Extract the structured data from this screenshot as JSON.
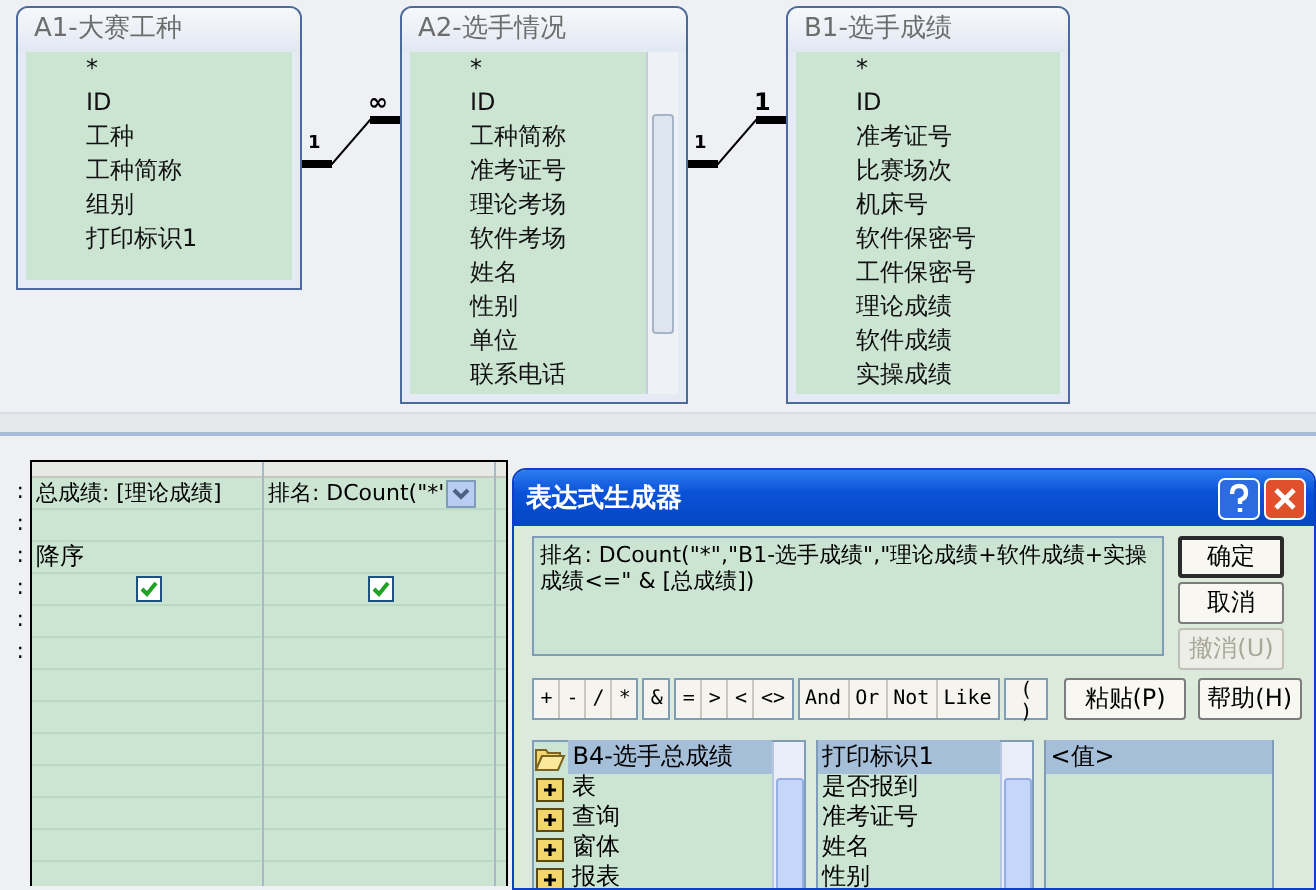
{
  "tables": [
    {
      "title": "A1-大赛工种",
      "fields": [
        "*",
        "ID",
        "工种",
        "工种简称",
        "组别",
        "打印标识1"
      ],
      "scrollbar": false
    },
    {
      "title": "A2-选手情况",
      "fields": [
        "*",
        "ID",
        "工种简称",
        "准考证号",
        "理论考场",
        "软件考场",
        "姓名",
        "性别",
        "单位",
        "联系电话"
      ],
      "scrollbar": true
    },
    {
      "title": "B1-选手成绩",
      "fields": [
        "*",
        "ID",
        "准考证号",
        "比赛场次",
        "机床号",
        "软件保密号",
        "工件保密号",
        "理论成绩",
        "软件成绩",
        "实操成绩"
      ],
      "scrollbar": false
    }
  ],
  "relationships": [
    {
      "from_label": "1",
      "to_label": "∞"
    },
    {
      "from_label": "1",
      "to_label": "1"
    }
  ],
  "grid": {
    "row_labels": [
      ":",
      ":",
      ":",
      ":",
      ":",
      ":"
    ],
    "columns": [
      {
        "field": "总成绩: [理论成绩]",
        "sort": "降序",
        "show": true,
        "dropdown": false
      },
      {
        "field": "排名: DCount(\"*'",
        "show": true,
        "dropdown": true
      }
    ]
  },
  "dialog": {
    "title": "表达式生成器",
    "expression": "排名: DCount(\"*\",\"B1-选手成绩\",\"理论成绩+软件成绩+实操成绩<=\" & [总成绩])",
    "buttons": [
      {
        "label": "确定",
        "default": true,
        "disabled": false
      },
      {
        "label": "取消",
        "default": false,
        "disabled": false
      },
      {
        "label": "撤消(U)",
        "default": false,
        "disabled": true
      }
    ],
    "operator_groups": [
      [
        "+",
        "-",
        "/",
        "*"
      ],
      [
        "&"
      ],
      [
        "=",
        ">",
        "<",
        "<>"
      ],
      [
        "And",
        "Or",
        "Not",
        "Like"
      ],
      [
        "( )"
      ]
    ],
    "paste_button": "粘贴(P)",
    "help_button": "帮助(H)",
    "tree": [
      {
        "label": "B4-选手总成绩",
        "kind": "open",
        "selected": true
      },
      {
        "label": "表",
        "kind": "closed",
        "selected": false
      },
      {
        "label": "查询",
        "kind": "closed",
        "selected": false
      },
      {
        "label": "窗体",
        "kind": "closed",
        "selected": false
      },
      {
        "label": "报表",
        "kind": "closed",
        "selected": false
      }
    ],
    "fields": [
      {
        "label": "打印标识1",
        "selected": true
      },
      {
        "label": "是否报到",
        "selected": false
      },
      {
        "label": "准考证号",
        "selected": false
      },
      {
        "label": "姓名",
        "selected": false
      },
      {
        "label": "性别",
        "selected": false
      }
    ],
    "values": [
      {
        "label": "<值>",
        "selected": true
      }
    ]
  }
}
